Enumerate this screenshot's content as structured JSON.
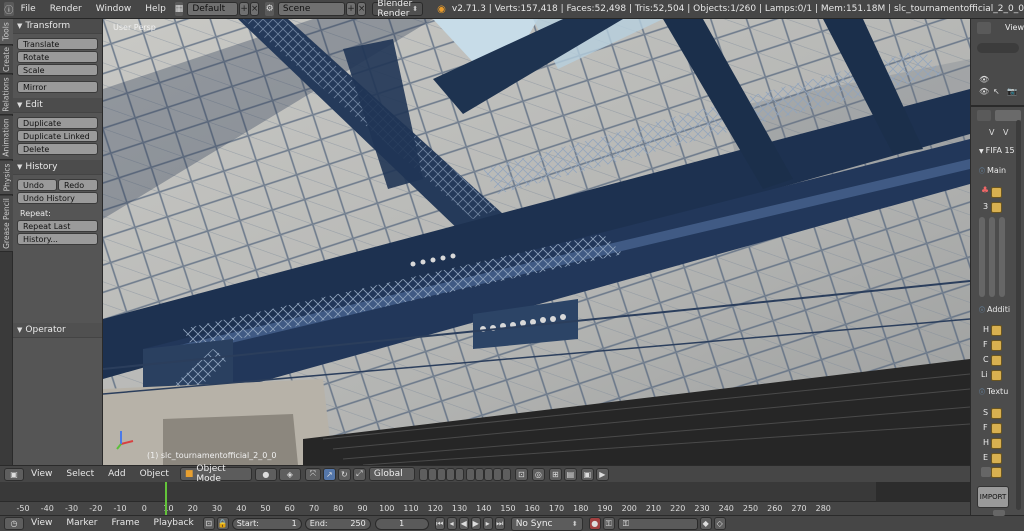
{
  "topbar": {
    "menus": [
      "File",
      "Render",
      "Window",
      "Help"
    ],
    "layout": "Default",
    "scene": "Scene",
    "engine": "Blender Render",
    "stats": "v2.71.3 | Verts:157,418 | Faces:52,498 | Tris:52,504 | Objects:1/260 | Lamps:0/1 | Mem:151.18M | slc_tournamentofficial_2_0_0"
  },
  "tabs": [
    "Tools",
    "Create",
    "Relations",
    "Animation",
    "Physics",
    "Grease Pencil"
  ],
  "toolshelf": {
    "transform": {
      "title": "Transform",
      "buttons": [
        "Translate",
        "Rotate",
        "Scale",
        "Mirror"
      ]
    },
    "edit": {
      "title": "Edit",
      "buttons": [
        "Duplicate",
        "Duplicate Linked",
        "Delete"
      ]
    },
    "history": {
      "title": "History",
      "undo": "Undo",
      "redo": "Redo",
      "undo_history": "Undo History",
      "repeat_label": "Repeat:",
      "repeat_last": "Repeat Last",
      "history": "History..."
    },
    "operator": {
      "title": "Operator"
    }
  },
  "viewport": {
    "label": "User Persp",
    "object": "(1) slc_tournamentofficial_2_0_0"
  },
  "view_header": {
    "menus": [
      "View",
      "Select",
      "Add",
      "Object"
    ],
    "mode": "Object Mode",
    "orientation": "Global"
  },
  "timeline": {
    "ticks": [
      "-50",
      "-40",
      "-30",
      "-20",
      "-10",
      "0",
      "10",
      "20",
      "30",
      "40",
      "50",
      "60",
      "70",
      "80",
      "90",
      "100",
      "110",
      "120",
      "130",
      "140",
      "150",
      "160",
      "170",
      "180",
      "190",
      "200",
      "210",
      "220",
      "230",
      "240",
      "250",
      "260",
      "270",
      "280"
    ],
    "menus": [
      "View",
      "Marker",
      "Frame",
      "Playback"
    ],
    "start_label": "Start:",
    "start_value": "1",
    "end_label": "End:",
    "end_value": "250",
    "current": "1",
    "sync": "No Sync"
  },
  "outliner": {
    "view": "View"
  },
  "properties": {
    "tab_labels": [
      "V",
      "V"
    ],
    "section_fifa": "FIFA 15",
    "section_main": "Main",
    "main_value": "3",
    "section_addit": "Additi",
    "addit_slots": [
      "H",
      "F",
      "C",
      "Li"
    ],
    "section_textu": "Textu",
    "textu_slots": [
      "S",
      "F",
      "H",
      "E"
    ],
    "import_label": "IMPORT"
  },
  "colors": {
    "girder": "#1e3350",
    "girder_light": "#34507a",
    "panel": "#b8b8b4",
    "grid": "#50627a",
    "sky": "#c7dce8",
    "timeline_cursor": "#63c43a"
  }
}
